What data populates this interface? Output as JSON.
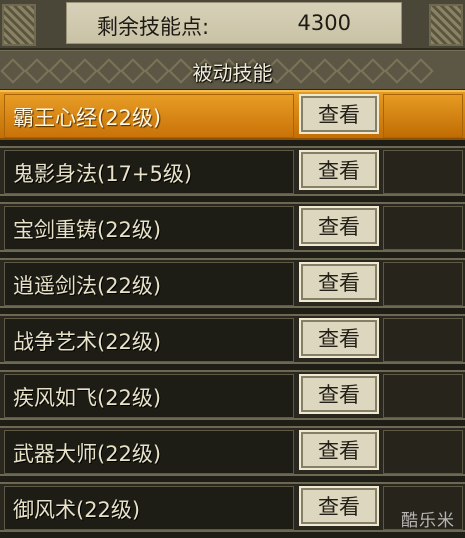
{
  "header": {
    "points_label": "剩余技能点:",
    "points_value": "4300"
  },
  "section": {
    "title": "被动技能"
  },
  "skills": [
    {
      "name": "霸王心经(22级)",
      "button": "查看"
    },
    {
      "name": "鬼影身法(17+5级)",
      "button": "查看"
    },
    {
      "name": "宝剑重铸(22级)",
      "button": "查看"
    },
    {
      "name": "逍遥剑法(22级)",
      "button": "查看"
    },
    {
      "name": "战争艺术(22级)",
      "button": "查看"
    },
    {
      "name": "疾风如飞(22级)",
      "button": "查看"
    },
    {
      "name": "武器大师(22级)",
      "button": "查看"
    },
    {
      "name": "御风术(22级)",
      "button": "查看"
    }
  ],
  "selected_index": 0,
  "colors": {
    "selected_row": "#d8850f",
    "row_bg": "#1e1d15",
    "button_bg": "#ddd7bf"
  },
  "watermark": "酷乐米"
}
